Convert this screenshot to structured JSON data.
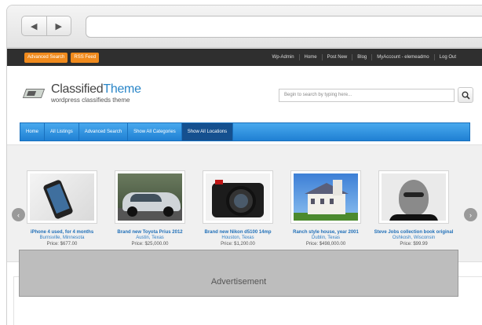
{
  "admin_bar": {
    "left_buttons": [
      "Advanced Search",
      "RSS Feed"
    ],
    "right_links": [
      "Wp-Admin",
      "Home",
      "Post New",
      "Blog",
      "MyAccount - elemeadmo",
      "Log Out"
    ]
  },
  "header": {
    "logo_prefix": "Classified",
    "logo_suffix": "Theme",
    "tagline": "wordpress classifieds theme",
    "search_placeholder": "Begin to search by typing here..."
  },
  "nav": {
    "items": [
      "Home",
      "All Listings",
      "Advanced Search",
      "Show All Categories",
      "Show All Locations"
    ],
    "active_index": 4
  },
  "listings": [
    {
      "title": "iPhone 4 used, for 4 months",
      "location": "Burnsville, Minnesota",
      "price": "Price: $677.00",
      "image": "phone"
    },
    {
      "title": "Brand new Toyota Prius 2012",
      "location": "Austin, Texas",
      "price": "Price: $25,000.00",
      "image": "car"
    },
    {
      "title": "Brand new Nikon d5100 14mp",
      "location": "Houston, Texas",
      "price": "Price: $1,200.00",
      "image": "camera"
    },
    {
      "title": "Ranch style house, year 2001",
      "location": "Dublin, Texas",
      "price": "Price: $498,000.00",
      "image": "house"
    },
    {
      "title": "Steve Jobs collection book original",
      "location": "Oshkosh, Wisconsin",
      "price": "Price: $99.99",
      "image": "portrait"
    }
  ],
  "advert": {
    "label": "Advertisement"
  },
  "colors": {
    "accent": "#2a86c8",
    "admin_button": "#f08a1c",
    "nav": "#1f80d3"
  }
}
